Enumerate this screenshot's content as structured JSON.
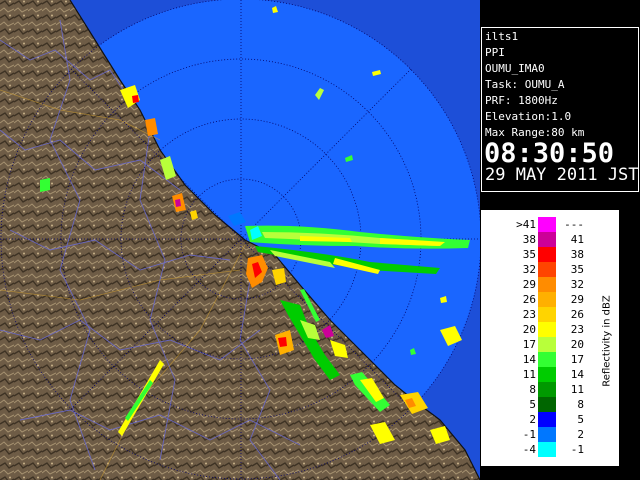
{
  "info": {
    "site": "ilts1",
    "scan_type": "PPI",
    "product": "OUMU_IMA0",
    "task": "Task: OUMU_A",
    "prf": "PRF: 1800Hz",
    "elevation": "Elevation:1.0",
    "max_range": "Max Range:80 km",
    "time": "08:30:50",
    "date": "29 MAY 2011 JST"
  },
  "legend": {
    "unit_label": "Reflectivity in dBZ",
    "rows": [
      {
        "low": ">41",
        "high": "---",
        "color": "#ff00ff"
      },
      {
        "low": "38",
        "high": "41",
        "color": "#cc0099"
      },
      {
        "low": "35",
        "high": "38",
        "color": "#ff0000"
      },
      {
        "low": "32",
        "high": "35",
        "color": "#ff4400"
      },
      {
        "low": "29",
        "high": "32",
        "color": "#ff8c00"
      },
      {
        "low": "26",
        "high": "29",
        "color": "#ffb000"
      },
      {
        "low": "23",
        "high": "26",
        "color": "#ffd400"
      },
      {
        "low": "20",
        "high": "23",
        "color": "#ffff00"
      },
      {
        "low": "17",
        "high": "20",
        "color": "#b8ff3a"
      },
      {
        "low": "14",
        "high": "17",
        "color": "#33ff33"
      },
      {
        "low": "11",
        "high": "14",
        "color": "#00cc00"
      },
      {
        "low": "8",
        "high": "11",
        "color": "#009900"
      },
      {
        "low": "5",
        "high": "8",
        "color": "#006600"
      },
      {
        "low": "2",
        "high": "5",
        "color": "#0000ff"
      },
      {
        "low": "-1",
        "high": "2",
        "color": "#0077ff"
      },
      {
        "low": "-4",
        "high": "-1",
        "color": "#00ffff"
      }
    ]
  },
  "colors": {
    "sea_coverage": "#1a66ff",
    "sea_outside": "#1d4fd8",
    "land": "#6b5a45",
    "range_rings": "#000066"
  }
}
